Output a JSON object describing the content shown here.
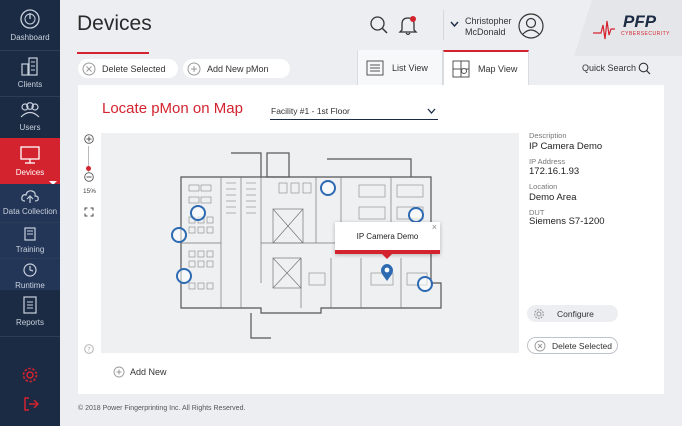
{
  "sidebar": {
    "items": [
      {
        "label": "Dashboard",
        "icon": "dashboard-icon"
      },
      {
        "label": "Clients",
        "icon": "buildings-icon"
      },
      {
        "label": "Users",
        "icon": "users-icon"
      },
      {
        "label": "Devices",
        "icon": "monitor-icon",
        "active": true
      },
      {
        "label": "Data Collection",
        "icon": "cloud-upload-icon"
      },
      {
        "label": "Training",
        "icon": "book-icon"
      },
      {
        "label": "Runtime",
        "icon": "clock-icon"
      },
      {
        "label": "Reports",
        "icon": "document-icon"
      }
    ],
    "settings_icon": "gear-icon",
    "logout_icon": "logout-icon"
  },
  "header": {
    "title": "Devices",
    "user_first": "Christopher",
    "user_last": "McDonald",
    "brand_name": "PFP",
    "brand_sub": "CYBERSECURITY"
  },
  "toolbar": {
    "delete_selected": "Delete Selected",
    "add_new_pmon": "Add New pMon",
    "list_view": "List View",
    "map_view": "Map View",
    "quick_search": "Quick Search"
  },
  "main": {
    "heading": "Locate pMon on Map",
    "facility_selected": "Facility #1 - 1st Floor",
    "zoom_level": "15%",
    "add_new": "Add New"
  },
  "popup": {
    "title": "IP Camera Demo"
  },
  "device_info": {
    "description_label": "Description",
    "description_value": "IP Camera Demo",
    "ip_label": "IP Address",
    "ip_value": "172.16.1.93",
    "location_label": "Location",
    "location_value": "Demo Area",
    "dut_label": "DUT",
    "dut_value": "Siemens S7-1200",
    "configure": "Configure",
    "delete_selected": "Delete Selected"
  },
  "footer": {
    "copyright": "© 2018 Power Fingerprinting Inc. All Rights Reserved."
  },
  "colors": {
    "accent": "#d3232f",
    "sidebar": "#1c2b44",
    "marker": "#2d6ab1"
  }
}
